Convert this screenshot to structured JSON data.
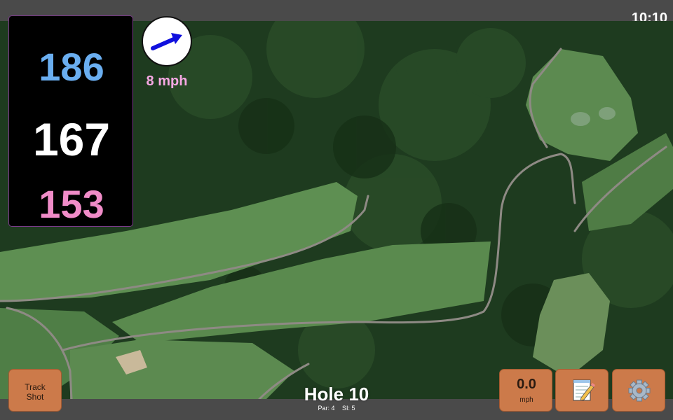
{
  "status_bar": {
    "time": "10:10"
  },
  "distances": {
    "back": "186",
    "middle": "167",
    "front": "153"
  },
  "wind": {
    "speed_label": "8 mph",
    "icon": "wind-arrow-icon"
  },
  "hole": {
    "title": "Hole 10",
    "par": "Par: 4",
    "stroke_index": "SI: 5"
  },
  "buttons": {
    "track_shot_line1": "Track",
    "track_shot_line2": "Shot",
    "speed_value": "0.0",
    "speed_unit": "mph",
    "notes_icon": "notepad-icon",
    "settings_icon": "gear-icon"
  },
  "colors": {
    "back_distance": "#6aaef0",
    "middle_distance": "#ffffff",
    "front_distance": "#f08cc8",
    "wind_text": "#f7a8e4",
    "button": "#cc7a4a",
    "wind_arrow": "#1010dd"
  }
}
